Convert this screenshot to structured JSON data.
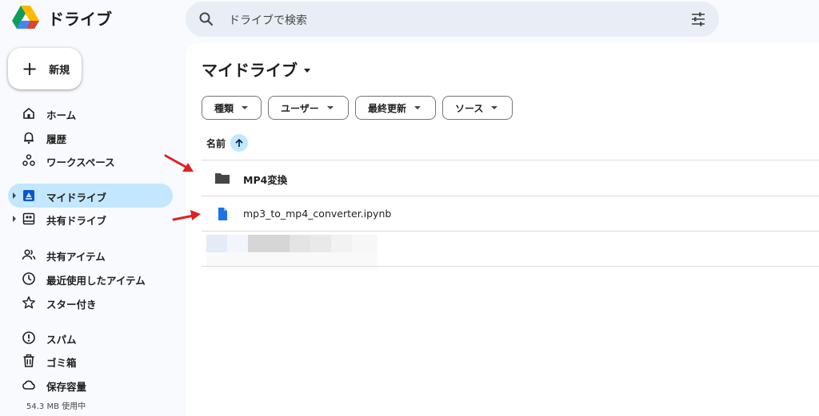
{
  "app": {
    "title": "ドライブ"
  },
  "search": {
    "placeholder": "ドライブで検索"
  },
  "sidebar": {
    "new_label": "新規",
    "items": [
      {
        "label": "ホーム",
        "icon": "home-icon"
      },
      {
        "label": "履歴",
        "icon": "bell-icon"
      },
      {
        "label": "ワークスペース",
        "icon": "workspaces-icon"
      },
      {
        "label": "マイドライブ",
        "icon": "my-drive-icon",
        "active": true
      },
      {
        "label": "共有ドライブ",
        "icon": "shared-drives-icon"
      },
      {
        "label": "共有アイテム",
        "icon": "people-icon"
      },
      {
        "label": "最近使用したアイテム",
        "icon": "clock-icon"
      },
      {
        "label": "スター付き",
        "icon": "star-icon"
      },
      {
        "label": "スパム",
        "icon": "spam-icon"
      },
      {
        "label": "ゴミ箱",
        "icon": "trash-icon"
      },
      {
        "label": "保存容量",
        "icon": "cloud-icon"
      }
    ],
    "storage_text": "54.3 MB 使用中"
  },
  "main": {
    "title": "マイドライブ",
    "filters": [
      "種類",
      "ユーザー",
      "最終更新",
      "ソース"
    ],
    "column_name": "名前",
    "files": [
      {
        "name": "MP4変換",
        "type": "folder"
      },
      {
        "name": "mp3_to_mp4_converter.ipynb",
        "type": "file"
      }
    ]
  },
  "colors": {
    "accent": "#c2e7ff",
    "background": "#f8fafd",
    "search_bg": "#e9eef6",
    "annotation_arrow": "#e02020"
  }
}
